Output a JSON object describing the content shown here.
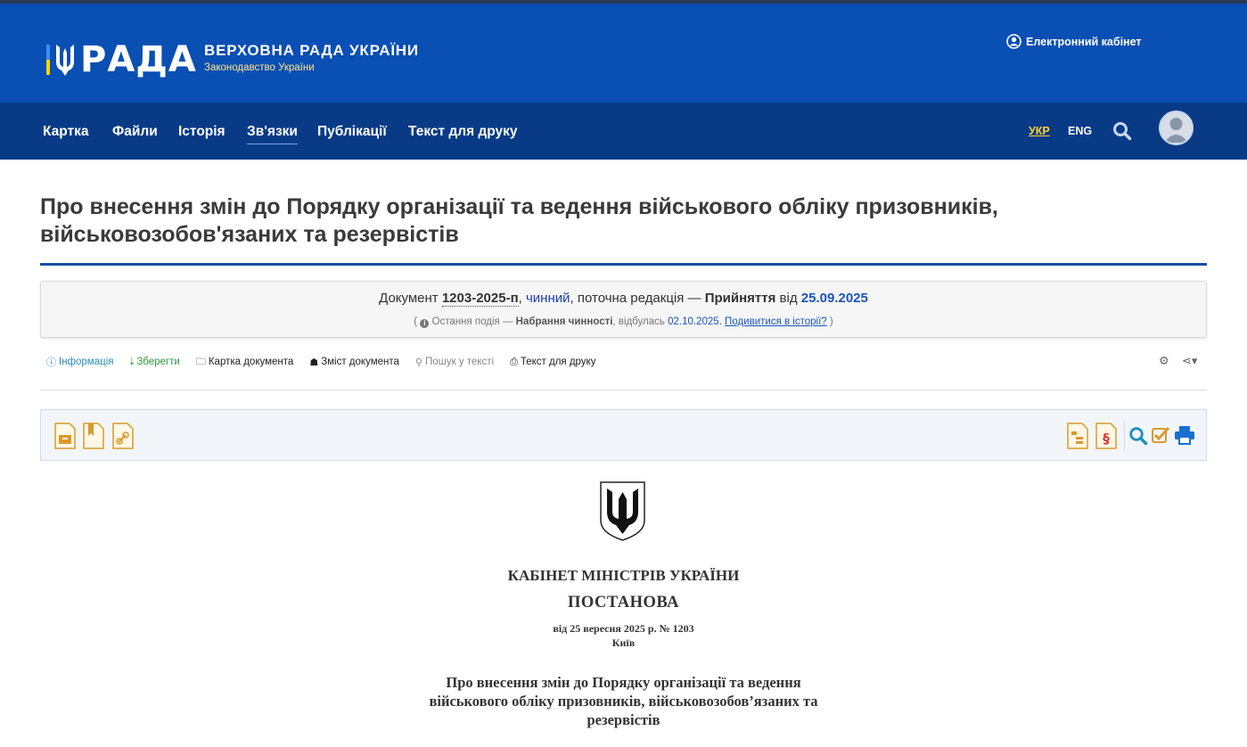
{
  "header": {
    "logo_word": "РАДА",
    "org_name": "ВЕРХОВНА РАДА УКРАЇНИ",
    "org_subtitle": "Законодавство України",
    "e_cabinet": "Електронний кабінет",
    "brand_colors": {
      "top": "#0a4fb3",
      "nav": "#083a86",
      "flag_blue": "#3e8cf5",
      "flag_yellow": "#ffd500"
    }
  },
  "nav": {
    "items": [
      "Картка",
      "Файли",
      "Історія",
      "Зв'язки",
      "Публікації",
      "Текст для друку"
    ],
    "active": "Зв'язки",
    "lang_ukr": "УКР",
    "lang_eng": "ENG"
  },
  "document": {
    "title": "Про внесення змін до Порядку організації та ведення військового обліку призовників, військовозобов'язаних та резервістів"
  },
  "status": {
    "prefix": "Документ",
    "number": "1203-2025-п",
    "state": "чинний",
    "middle": ", поточна редакція —",
    "event": "Прийняття",
    "from": "від",
    "date": "25.09.2025",
    "last_event_prefix": "Остання подія —",
    "last_event": "Набрання чинності",
    "happened": ", відбулась",
    "last_event_date": "02.10.2025.",
    "history_link": "Подивитися в історії?"
  },
  "tools": {
    "info": "Інформація",
    "save": "Зберегти",
    "card": "Картка документа",
    "contents": "Зміст документа",
    "search": "Пошук у тексті",
    "print": "Текст для друку"
  },
  "doc_body": {
    "cabinet": "КАБІНЕТ МІНІСТРІВ УКРАЇНИ",
    "type": "ПОСТАНОВА",
    "date_line": "від 25 вересня 2025 р. № 1203",
    "city": "Київ",
    "subject": "Про внесення змін до Порядку організації та ведення військового обліку призовників, військовозобов’язаних та резервістів"
  }
}
